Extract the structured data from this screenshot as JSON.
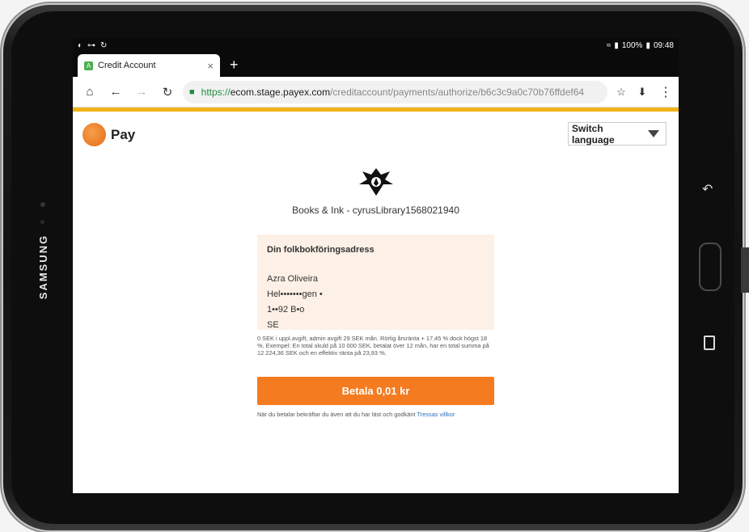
{
  "device": {
    "brand": "SAMSUNG"
  },
  "status_bar": {
    "battery": "100%",
    "time": "09:48"
  },
  "browser": {
    "tab": {
      "title": "Credit Account",
      "close": "×"
    },
    "new_tab": "+",
    "url": {
      "scheme": "https://",
      "host": "ecom.stage.payex.com",
      "path": "/creditaccount/payments/authorize/b6c3c9a0c70b76ffdef64"
    }
  },
  "page": {
    "logo_text": "Pay",
    "language_button": "Switch language",
    "merchant": "Books & Ink - cyrusLibrary1568021940",
    "address": {
      "title": "Din folkbokföringsadress",
      "name": "Azra Oliveira",
      "street": "Hel•••••••gen •",
      "postal": "1••92 B•o",
      "country": "SE"
    },
    "terms": "0 SEK i uppl.avgift, admin avgift 29 SEK mån. Rörlig årsränta + 17,45 % dock högst 18 %. Exempel: En total skuld på 10 000 SEK, betalat över 12 mån, har en total summa på 12 224,36 SEK och en effektiv ränta på 23,93 %.",
    "pay_button": "Betala 0,01 kr",
    "consent_text": "När du betalar bekräftar du även att du har läst och godkänt",
    "consent_link": "Tressas villkor"
  },
  "colors": {
    "accent": "#f47b20",
    "rule": "#f1b418",
    "card_bg": "#fdf0e6"
  },
  "icons": [
    "back-arrow-icon",
    "forward-arrow-icon",
    "reload-icon",
    "home-icon",
    "lock-icon",
    "star-icon",
    "download-icon",
    "menu-icon",
    "wifi-icon",
    "signal-icon",
    "battery-icon",
    "caret-down-icon"
  ]
}
